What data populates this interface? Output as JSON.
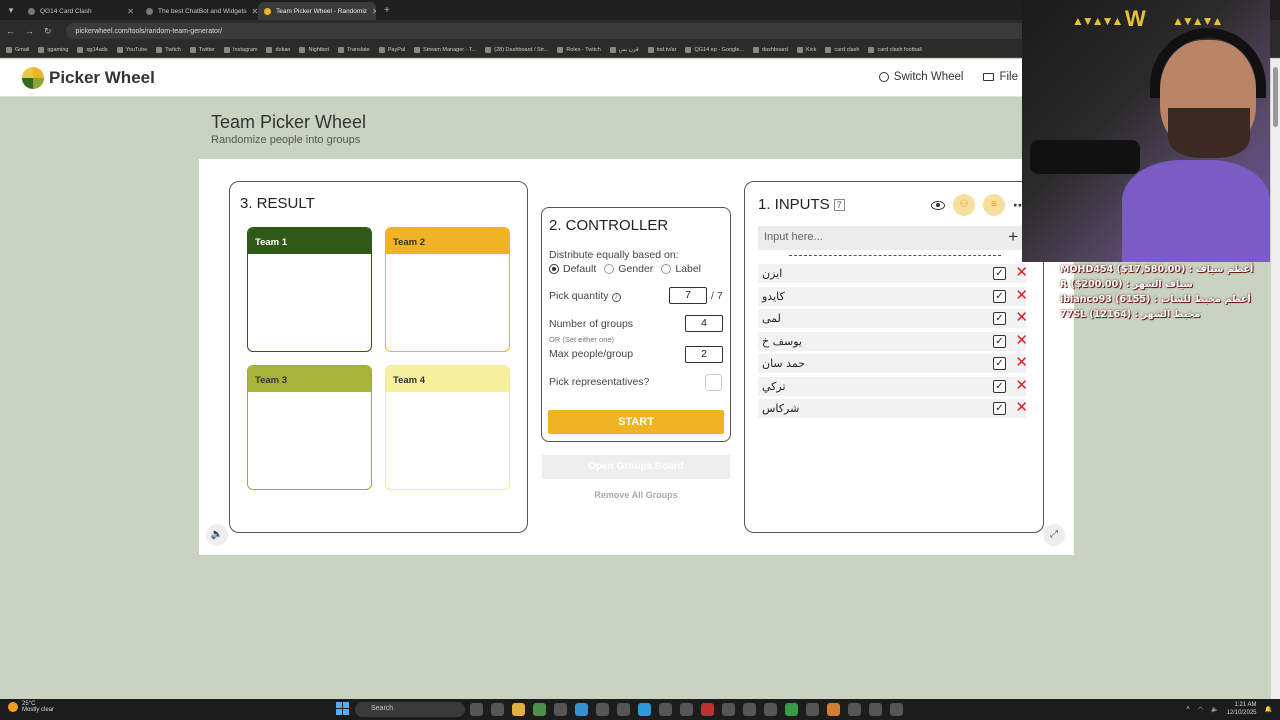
{
  "browser": {
    "tabs": [
      {
        "label": "QG14 Card Clash",
        "active": false
      },
      {
        "label": "The best ChatBot and Widgets",
        "active": false
      },
      {
        "label": "Team Picker Wheel - Randomiz",
        "active": true
      }
    ],
    "url": "pickerwheel.com/tools/random-team-generator/",
    "bookmarks": [
      "Gmail",
      "qgaming",
      "qg14ads",
      "YouTube",
      "Twitch",
      "Twitter",
      "Instagram",
      "dokan",
      "Nightbot",
      "Translate",
      "PayPal",
      "Stream Manager - T...",
      "(28) Dashboard / Str...",
      "Roles - Twitch",
      "قرن بس",
      "tod.tv/ar",
      "QG14 ep - Google...",
      "dashboard",
      "Kick",
      "card clash",
      "card clash football"
    ]
  },
  "site": {
    "logo_text": "Picker Wheel",
    "nav": {
      "switch_wheel": "Switch Wheel",
      "file": "File"
    }
  },
  "page": {
    "title": "Team Picker Wheel",
    "subtitle": "Randomize people into groups"
  },
  "result": {
    "title": "3. RESULT",
    "teams": [
      "Team 1",
      "Team 2",
      "Team 3",
      "Team 4"
    ]
  },
  "controller": {
    "title": "2. CONTROLLER",
    "distribute_label": "Distribute equally based on:",
    "options": [
      "Default",
      "Gender",
      "Label"
    ],
    "selected_option": "Default",
    "pick_quantity_label": "Pick quantity",
    "pick_quantity_value": "7",
    "pick_quantity_total": "/ 7",
    "groups_label": "Number of groups",
    "groups_value": "4",
    "or_note": "OR (Set either one)",
    "max_label": "Max people/group",
    "max_value": "2",
    "representatives_label": "Pick representatives?",
    "start_label": "START",
    "open_groups_label": "Open Groups Board",
    "remove_all_label": "Remove All Groups"
  },
  "inputs": {
    "title": "1. INPUTS",
    "count": "7",
    "placeholder": "Input here...",
    "entries": [
      "ايزن",
      "كايدو",
      "لمى",
      "يوسف خ",
      "حمد سان",
      "تركي",
      "شركاس"
    ]
  },
  "overlay": {
    "chat": [
      "MOHD454 ($17,580.00) : أعظم سياف",
      "R ($200.00) : سياف الشهر",
      "ibianco93 (6155) : أعظم مخبط للشات",
      "77SL (12164) : مخبط الشهر"
    ]
  },
  "taskbar": {
    "weather_temp": "25°C",
    "weather_desc": "Mostly clear",
    "search": "Search",
    "time": "1:21 AM",
    "date": "12/10/2025"
  },
  "colors": {
    "team1": "#2e5a18",
    "team2": "#f0b323",
    "team3": "#a8b33a",
    "team4": "#f5ef9e",
    "start": "#f0b323",
    "delete": "#dd2222"
  }
}
